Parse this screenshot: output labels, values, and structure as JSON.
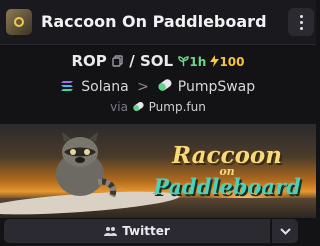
{
  "header": {
    "title": "Raccoon On Paddleboard",
    "avatar_icon": "token-avatar",
    "menu_icon": "more-vertical-icon"
  },
  "pair": {
    "base": "ROP",
    "quote": "SOL",
    "separator": "/",
    "age_label": "1h",
    "boost_label": "100"
  },
  "route": {
    "chain": "Solana",
    "arrow": ">",
    "dex": "PumpSwap"
  },
  "launchpad": {
    "prefix": "via",
    "name": "Pump.fun"
  },
  "banner": {
    "line1": "Raccoon",
    "line2": "on",
    "line3": "Paddleboard"
  },
  "actions": {
    "twitter_label": "Twitter",
    "twitter_icon": "people-icon",
    "dropdown_icon": "chevron-down-icon"
  },
  "colors": {
    "age": "#6fd98a",
    "boost": "#f5c53a",
    "banner_teal": "#4fd0b8",
    "banner_gold": "#f6d97a"
  }
}
